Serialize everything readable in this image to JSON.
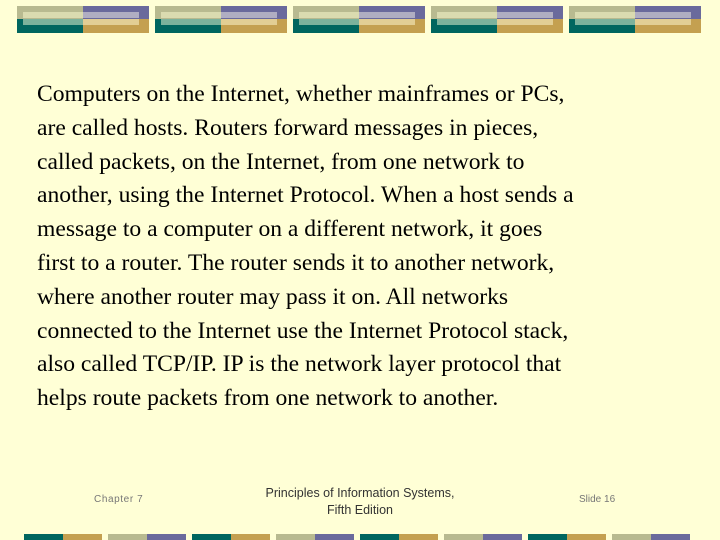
{
  "slide": {
    "body_lines": [
      "Computers on the Internet, whether mainframes or PCs,",
      "are called hosts.  Routers forward messages in pieces,",
      "called packets, on the Internet, from one network to",
      "another, using the Internet Protocol.  When a host sends a",
      "message to a computer on a different network, it goes",
      "first to a router.  The router sends it to another network,",
      "where another router may pass it on.   All networks",
      "connected to the Internet use the Internet Protocol stack,",
      "also called TCP/IP.  IP is the network layer protocol that",
      "helps route packets from one network to another."
    ]
  },
  "footer": {
    "chapter": "Chapter 7",
    "book_title_line1": "Principles of Information Systems,",
    "book_title_line2": "Fifth Edition",
    "slide_number": "Slide 16"
  },
  "theme": {
    "background": "#FFFFD6",
    "sage": "#B8BA90",
    "purple": "#6A6A9C",
    "teal": "#00665F",
    "gold": "#C4A050"
  }
}
